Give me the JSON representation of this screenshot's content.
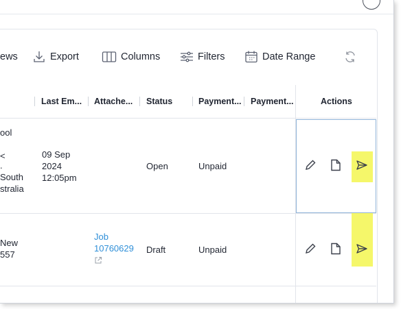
{
  "toolbar": {
    "views_label": "ews",
    "export_label": "Export",
    "columns_label": "Columns",
    "filters_label": "Filters",
    "date_range_label": "Date Range"
  },
  "table": {
    "headers": {
      "last_email": "Last Em...",
      "attachments": "Attache...",
      "status": "Status",
      "payment1": "Payment...",
      "payment2": "Payment...",
      "actions": "Actions"
    },
    "rows": [
      {
        "address_lines": [
          "ool",
          "<",
          ".",
          "South",
          "stralia"
        ],
        "last_email_lines": [
          "09 Sep",
          "2024",
          "12:05pm"
        ],
        "attachment_lines": [],
        "status": "Open",
        "payment": "Unpaid"
      },
      {
        "address_lines": [
          "New",
          "557"
        ],
        "last_email_lines": [],
        "attachment_lines": [
          "Job",
          "10760629"
        ],
        "status": "Draft",
        "payment": "Unpaid"
      }
    ]
  },
  "colors": {
    "highlight": "#f5f76a",
    "link": "#2f8fd8",
    "selection_border": "#8fb3d9"
  },
  "icons": {
    "help": "help-circle-icon",
    "export": "download-icon",
    "columns": "columns-icon",
    "filters": "sliders-icon",
    "date_range": "calendar-icon",
    "refresh": "refresh-icon",
    "edit": "pencil-icon",
    "document": "document-icon",
    "send": "send-icon",
    "external": "external-link-icon"
  }
}
